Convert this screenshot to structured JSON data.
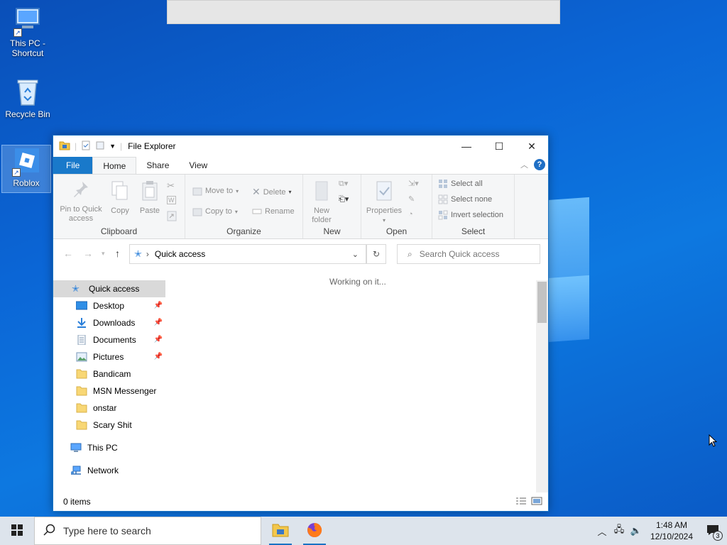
{
  "desktop": {
    "icons": [
      {
        "label": "This PC - Shortcut"
      },
      {
        "label": "Recycle Bin"
      },
      {
        "label": "Roblox"
      }
    ]
  },
  "window": {
    "title": "File Explorer",
    "controls": {
      "minimize": "—",
      "maximize": "☐",
      "close": "✕"
    },
    "tabs": [
      "File",
      "Home",
      "Share",
      "View"
    ],
    "help": "?",
    "ribbon": {
      "clipboard": {
        "label": "Clipboard",
        "pin": "Pin to Quick access",
        "copy": "Copy",
        "paste": "Paste"
      },
      "organize": {
        "label": "Organize",
        "move_to": "Move to",
        "copy_to": "Copy to",
        "delete": "Delete",
        "rename": "Rename"
      },
      "new": {
        "label": "New",
        "new_folder": "New folder"
      },
      "open": {
        "label": "Open",
        "properties": "Properties"
      },
      "select": {
        "label": "Select",
        "select_all": "Select all",
        "select_none": "Select none",
        "invert": "Invert selection"
      }
    },
    "address": {
      "path": "Quick access",
      "search_placeholder": "Search Quick access"
    },
    "nav": {
      "quick_access": "Quick access",
      "items": [
        {
          "label": "Desktop",
          "pinned": true
        },
        {
          "label": "Downloads",
          "pinned": true
        },
        {
          "label": "Documents",
          "pinned": true
        },
        {
          "label": "Pictures",
          "pinned": true
        },
        {
          "label": "Bandicam",
          "pinned": false
        },
        {
          "label": "MSN Messenger",
          "pinned": false
        },
        {
          "label": "onstar",
          "pinned": false
        },
        {
          "label": "Scary Shit",
          "pinned": false
        }
      ],
      "this_pc": "This PC",
      "network": "Network"
    },
    "content": {
      "status_message": "Working on it..."
    },
    "status": {
      "items": "0 items"
    }
  },
  "taskbar": {
    "search_placeholder": "Type here to search",
    "clock": {
      "time": "1:48 AM",
      "date": "12/10/2024"
    },
    "notification_count": "3"
  },
  "colors": {
    "accent": "#1979ca",
    "desktop": "#0b66d6"
  }
}
